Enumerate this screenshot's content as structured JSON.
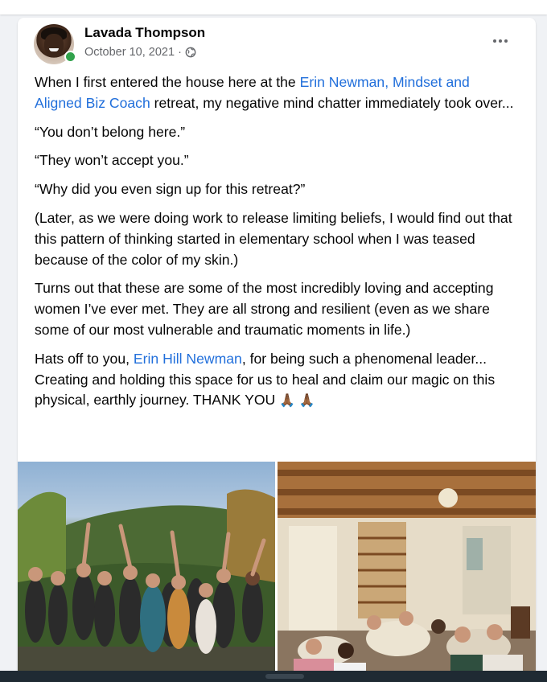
{
  "post": {
    "author": "Lavada Thompson",
    "date": "October 10, 2021",
    "separator": "·",
    "audience_icon": "globe-icon",
    "more_icon": "more-options-icon",
    "paragraph1_before": "When I first entered the house here at the ",
    "paragraph1_link": "Erin Newman, Mindset and Aligned Biz Coach",
    "paragraph1_after": " retreat, my negative mind chatter immediately took over...",
    "quote1": "“You don’t belong here.”",
    "quote2": "“They won’t accept you.”",
    "quote3": "“Why did you even sign up for this retreat?”",
    "paragraph2": "(Later, as we were doing work to release limiting beliefs, I would find out that this pattern of thinking started in elementary school when I was teased because of the color of my skin.)",
    "paragraph3": "Turns out that these are some of the most incredibly loving and accepting women I’ve ever met. They are all strong and resilient (even as we share some of our most vulnerable and traumatic moments in life.)",
    "paragraph4_before": "Hats off to you, ",
    "paragraph4_link": "Erin Hill Newman",
    "paragraph4_after": ", for being such a phenomenal leader... Creating and holding this space for us to heal and claim our magic on this physical, earthly journey. THANK YOU ",
    "emoji": "🙏🏾 🙏🏾"
  },
  "colors": {
    "link": "#216fdb",
    "online": "#31a24c",
    "meta": "#65676b"
  }
}
